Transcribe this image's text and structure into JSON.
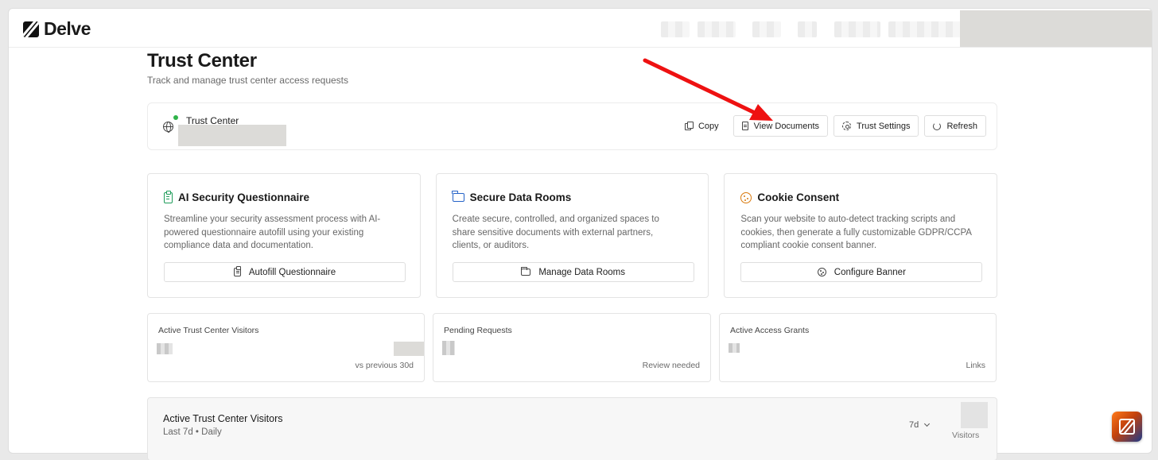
{
  "brand": {
    "name": "Delve"
  },
  "header": {
    "title": "Trust Center",
    "subtitle": "Track and manage trust center access requests"
  },
  "trust_center_bar": {
    "label": "Trust Center",
    "status_color": "#2fb34a",
    "actions": {
      "copy": "Copy",
      "view_documents": "View Documents",
      "trust_settings": "Trust Settings",
      "refresh": "Refresh"
    }
  },
  "cards": [
    {
      "title": "AI Security Questionnaire",
      "icon": "clipboard-icon",
      "icon_color": "#1f9c5a",
      "description": "Streamline your security assessment process with AI-powered questionnaire autofill using your existing compliance data and documentation.",
      "button": "Autofill Questionnaire"
    },
    {
      "title": "Secure Data Rooms",
      "icon": "folder-icon",
      "icon_color": "#2563c8",
      "description": "Create secure, controlled, and organized spaces to share sensitive documents with external partners, clients, or auditors.",
      "button": "Manage Data Rooms"
    },
    {
      "title": "Cookie Consent",
      "icon": "cookie-icon",
      "icon_color": "#d97a0e",
      "description": "Scan your website to auto-detect tracking scripts and cookies, then generate a fully customizable GDPR/CCPA compliant cookie consent banner.",
      "button": "Configure Banner"
    }
  ],
  "stats": [
    {
      "label": "Active Trust Center Visitors",
      "footnote": "vs previous 30d"
    },
    {
      "label": "Pending Requests",
      "footnote": "Review needed"
    },
    {
      "label": "Active Access Grants",
      "footnote": "Links"
    }
  ],
  "chart_panel": {
    "title": "Active Trust Center Visitors",
    "subtitle": "Last 7d • Daily",
    "range": "7d",
    "legend": "Visitors"
  },
  "annotation": {
    "arrow_color": "#ee1111"
  }
}
